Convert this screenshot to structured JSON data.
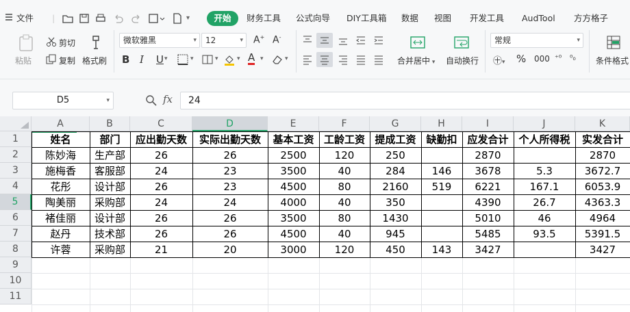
{
  "menu": {
    "file": "文件",
    "tabs": [
      "开始",
      "财务工具",
      "公式向导",
      "DIY工具箱",
      "数据",
      "视图",
      "开发工具",
      "AudTool",
      "方方格子"
    ]
  },
  "ribbon": {
    "paste": "粘贴",
    "cut": "剪切",
    "copy": "复制",
    "format_painter": "格式刷",
    "font_name": "微软雅黑",
    "font_size": "12",
    "bold": "B",
    "italic": "I",
    "underline": "U",
    "merge": "合并居中",
    "wrap": "自动换行",
    "number_format": "常规",
    "percent": "%",
    "thousands": "000",
    "cond_format": "条件格式"
  },
  "formula_bar": {
    "cell_ref": "D5",
    "fx": "fx",
    "value": "24"
  },
  "sheet": {
    "columns": [
      "A",
      "B",
      "C",
      "D",
      "E",
      "F",
      "G",
      "H",
      "I",
      "J",
      "K"
    ],
    "rows": [
      "1",
      "2",
      "3",
      "4",
      "5",
      "6",
      "7",
      "8",
      "9",
      "10",
      "11"
    ],
    "header": [
      "姓名",
      "部门",
      "应出勤天数",
      "实际出勤天数",
      "基本工资",
      "工龄工资",
      "提成工资",
      "缺勤扣",
      "应发合计",
      "个人所得税",
      "实发合计"
    ],
    "data": [
      [
        "陈妙海",
        "生产部",
        "26",
        "26",
        "2500",
        "120",
        "250",
        "",
        "2870",
        "",
        "2870"
      ],
      [
        "施梅香",
        "客服部",
        "24",
        "23",
        "3500",
        "40",
        "284",
        "146",
        "3678",
        "5.3",
        "3672.7"
      ],
      [
        "花彤",
        "设计部",
        "26",
        "23",
        "4500",
        "80",
        "2160",
        "519",
        "6221",
        "167.1",
        "6053.9"
      ],
      [
        "陶美丽",
        "采购部",
        "24",
        "24",
        "4000",
        "40",
        "350",
        "",
        "4390",
        "26.7",
        "4363.3"
      ],
      [
        "褚佳丽",
        "设计部",
        "26",
        "26",
        "3500",
        "80",
        "1430",
        "",
        "5010",
        "46",
        "4964"
      ],
      [
        "赵丹",
        "技术部",
        "26",
        "26",
        "4500",
        "40",
        "945",
        "",
        "5485",
        "93.5",
        "5391.5"
      ],
      [
        "许蓉",
        "采购部",
        "21",
        "20",
        "3000",
        "120",
        "450",
        "143",
        "3427",
        "",
        "3427"
      ]
    ],
    "selected_cell": "D5",
    "accent": "#21a366"
  }
}
